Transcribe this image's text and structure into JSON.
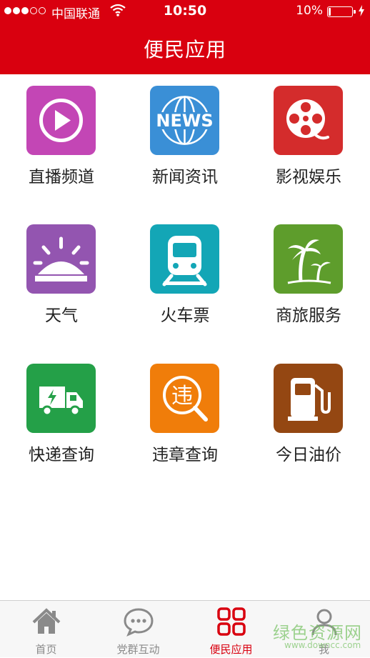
{
  "status_bar": {
    "carrier": "中国联通",
    "time": "10:50",
    "battery": "10%",
    "battery_level": 0.1
  },
  "header": {
    "title": "便民应用"
  },
  "apps": [
    {
      "label": "直播频道",
      "icon": "play-icon",
      "color": "#c346b5"
    },
    {
      "label": "新闻资讯",
      "icon": "news-globe-icon",
      "icon_text": "NEWS",
      "color": "#3a8fd6"
    },
    {
      "label": "影视娱乐",
      "icon": "film-reel-icon",
      "color": "#d42c2c"
    },
    {
      "label": "天气",
      "icon": "sunrise-icon",
      "color": "#9355b0"
    },
    {
      "label": "火车票",
      "icon": "train-icon",
      "color": "#13a6b6"
    },
    {
      "label": "商旅服务",
      "icon": "palm-tree-icon",
      "color": "#5e9d2c"
    },
    {
      "label": "快递查询",
      "icon": "delivery-truck-icon",
      "color": "#24a048"
    },
    {
      "label": "违章查询",
      "icon": "violation-search-icon",
      "icon_text": "违",
      "color": "#f07d0a"
    },
    {
      "label": "今日油价",
      "icon": "fuel-pump-icon",
      "color": "#944712"
    }
  ],
  "tabbar": {
    "tabs": [
      {
        "label": "首页",
        "icon": "home-icon"
      },
      {
        "label": "党群互动",
        "icon": "chat-icon"
      },
      {
        "label": "便民应用",
        "icon": "grid-icon"
      },
      {
        "label": "我",
        "icon": "user-icon"
      }
    ],
    "active_color": "#d9000f",
    "inactive_color": "#8a8a8a"
  },
  "watermark": {
    "text": "绿色资源网",
    "url": "www.downcc.com"
  }
}
